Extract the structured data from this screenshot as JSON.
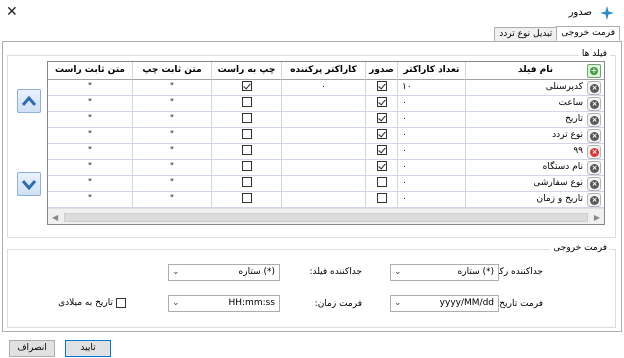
{
  "window": {
    "title": "صدور",
    "close_icon": "close-icon",
    "app_icon": "sparkle-icon"
  },
  "tabs": [
    {
      "label": "فرمت خروجی",
      "active": true
    },
    {
      "label": "تبدیل نوع تردد",
      "active": false
    }
  ],
  "fields_group": {
    "legend": "فیلد ها",
    "columns": {
      "field_name": "نام فیلد",
      "char_count": "تعداد کاراکتر",
      "export": "صدور",
      "filler_char": "کاراکتر پرکننده",
      "left_to_right": "چپ به راست",
      "fixed_text_left": "متن ثابت چپ",
      "fixed_text_right": "متن ثابت راست"
    },
    "rows": [
      {
        "name": "کدپرسنلی",
        "count": "۱۰",
        "export": true,
        "filler": "۰",
        "ltr": true,
        "left_text": "\"",
        "right_text": "\"",
        "remove_style": "gray"
      },
      {
        "name": "ساعت",
        "count": "۰",
        "export": true,
        "filler": "",
        "ltr": false,
        "left_text": "\"",
        "right_text": "\"",
        "remove_style": "gray"
      },
      {
        "name": "تاریخ",
        "count": "۰",
        "export": true,
        "filler": "",
        "ltr": false,
        "left_text": "\"",
        "right_text": "\"",
        "remove_style": "gray"
      },
      {
        "name": "نوع تردد",
        "count": "۰",
        "export": true,
        "filler": "",
        "ltr": false,
        "left_text": "\"",
        "right_text": "\"",
        "remove_style": "gray"
      },
      {
        "name": "۹۹",
        "count": "۰",
        "export": true,
        "filler": "",
        "ltr": false,
        "left_text": "\"",
        "right_text": "\"",
        "remove_style": "red"
      },
      {
        "name": "نام دستگاه",
        "count": "۰",
        "export": true,
        "filler": "",
        "ltr": false,
        "left_text": "\"",
        "right_text": "\"",
        "remove_style": "gray"
      },
      {
        "name": "نوع سفارشی",
        "count": "۰",
        "export": false,
        "filler": "",
        "ltr": false,
        "left_text": "\"",
        "right_text": "\"",
        "remove_style": "gray"
      },
      {
        "name": "تاریخ و زمان",
        "count": "۰",
        "export": false,
        "filler": "",
        "ltr": false,
        "left_text": "\"",
        "right_text": "\"",
        "remove_style": "gray"
      }
    ],
    "add_icon": "plus-icon",
    "move_up_icon": "chevron-up-icon",
    "move_down_icon": "chevron-down-icon"
  },
  "format_group": {
    "legend": "فرمت خروجی",
    "record_separator_label": "جداکننده رکورد:",
    "record_separator_value": "ستاره (*)",
    "field_separator_label": "جداکننده فیلد:",
    "field_separator_value": "ستاره (*)",
    "date_format_label": "فرمت تاریخ:",
    "date_format_value": "yyyy/MM/dd",
    "time_format_label": "فرمت زمان:",
    "time_format_value": "HH:mm:ss",
    "gregorian_label": "تاریخ به میلادی",
    "gregorian_checked": false
  },
  "buttons": {
    "ok": "تایید",
    "cancel": "انصراف"
  }
}
